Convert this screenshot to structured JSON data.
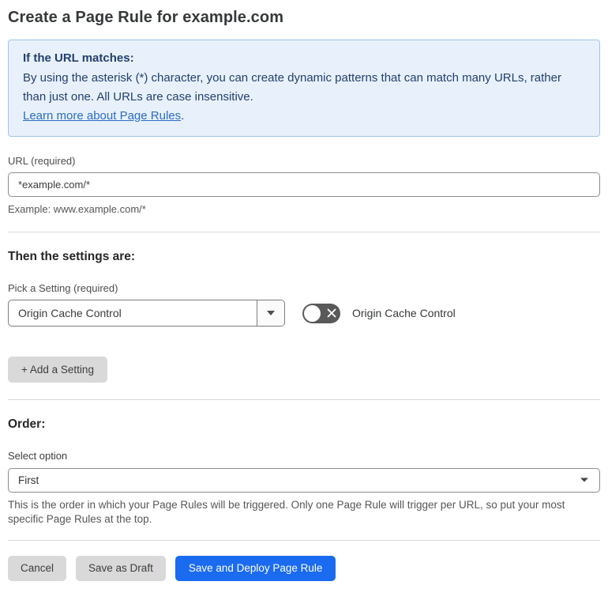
{
  "page": {
    "title": "Create a Page Rule for example.com"
  },
  "info_box": {
    "heading": "If the URL matches:",
    "body": "By using the asterisk (*) character, you can create dynamic patterns that can match many URLs, rather than just one. All URLs are case insensitive.",
    "link_label": "Learn more about Page Rules",
    "link_suffix": "."
  },
  "url_field": {
    "label": "URL (required)",
    "value": "*example.com/*",
    "helper": "Example: www.example.com/*"
  },
  "settings_section": {
    "heading": "Then the settings are:",
    "picker_label": "Pick a Setting (required)",
    "picker_value": "Origin Cache Control",
    "toggle_state": "off",
    "toggle_label": "Origin Cache Control",
    "add_setting_label": "+ Add a Setting"
  },
  "order_section": {
    "heading": "Order:",
    "select_label": "Select option",
    "select_value": "First",
    "helper": "This is the order in which your Page Rules will be triggered. Only one Page Rule will trigger per URL, so put your most specific Page Rules at the top."
  },
  "footer": {
    "cancel_label": "Cancel",
    "save_draft_label": "Save as Draft",
    "save_deploy_label": "Save and Deploy Page Rule"
  },
  "icons": {
    "toggle_off": "x-icon",
    "dropdown": "chevron-down-icon"
  },
  "colors": {
    "accent_blue": "#1a6bf0",
    "info_bg": "#e8f1fb",
    "info_border": "#9fc4ea",
    "info_text": "#23406e",
    "link_blue": "#2b6cc4",
    "toggle_off_bg": "#595959",
    "button_gray": "#d9d9d9",
    "divider": "#d9d9d9"
  }
}
